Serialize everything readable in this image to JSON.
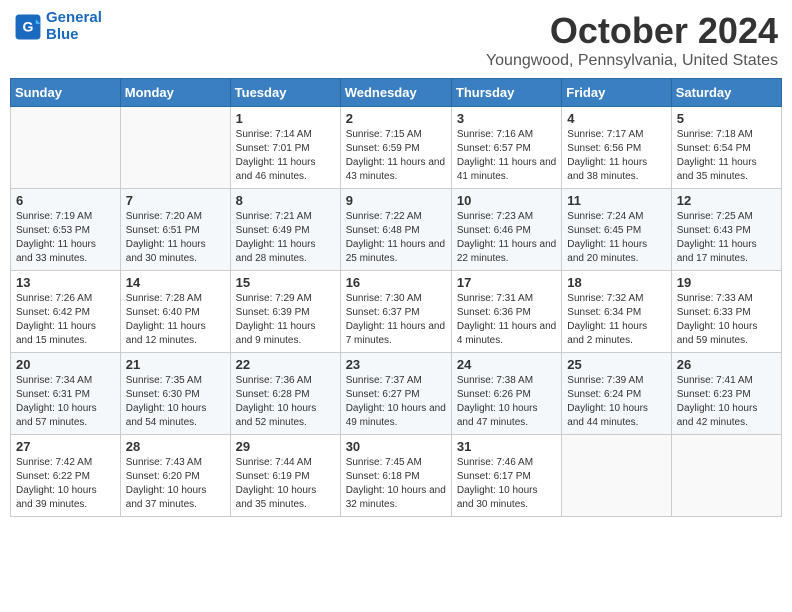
{
  "header": {
    "logo_line1": "General",
    "logo_line2": "Blue",
    "month": "October 2024",
    "location": "Youngwood, Pennsylvania, United States"
  },
  "weekdays": [
    "Sunday",
    "Monday",
    "Tuesday",
    "Wednesday",
    "Thursday",
    "Friday",
    "Saturday"
  ],
  "weeks": [
    [
      {
        "day": "",
        "sunrise": "",
        "sunset": "",
        "daylight": ""
      },
      {
        "day": "",
        "sunrise": "",
        "sunset": "",
        "daylight": ""
      },
      {
        "day": "1",
        "sunrise": "Sunrise: 7:14 AM",
        "sunset": "Sunset: 7:01 PM",
        "daylight": "Daylight: 11 hours and 46 minutes."
      },
      {
        "day": "2",
        "sunrise": "Sunrise: 7:15 AM",
        "sunset": "Sunset: 6:59 PM",
        "daylight": "Daylight: 11 hours and 43 minutes."
      },
      {
        "day": "3",
        "sunrise": "Sunrise: 7:16 AM",
        "sunset": "Sunset: 6:57 PM",
        "daylight": "Daylight: 11 hours and 41 minutes."
      },
      {
        "day": "4",
        "sunrise": "Sunrise: 7:17 AM",
        "sunset": "Sunset: 6:56 PM",
        "daylight": "Daylight: 11 hours and 38 minutes."
      },
      {
        "day": "5",
        "sunrise": "Sunrise: 7:18 AM",
        "sunset": "Sunset: 6:54 PM",
        "daylight": "Daylight: 11 hours and 35 minutes."
      }
    ],
    [
      {
        "day": "6",
        "sunrise": "Sunrise: 7:19 AM",
        "sunset": "Sunset: 6:53 PM",
        "daylight": "Daylight: 11 hours and 33 minutes."
      },
      {
        "day": "7",
        "sunrise": "Sunrise: 7:20 AM",
        "sunset": "Sunset: 6:51 PM",
        "daylight": "Daylight: 11 hours and 30 minutes."
      },
      {
        "day": "8",
        "sunrise": "Sunrise: 7:21 AM",
        "sunset": "Sunset: 6:49 PM",
        "daylight": "Daylight: 11 hours and 28 minutes."
      },
      {
        "day": "9",
        "sunrise": "Sunrise: 7:22 AM",
        "sunset": "Sunset: 6:48 PM",
        "daylight": "Daylight: 11 hours and 25 minutes."
      },
      {
        "day": "10",
        "sunrise": "Sunrise: 7:23 AM",
        "sunset": "Sunset: 6:46 PM",
        "daylight": "Daylight: 11 hours and 22 minutes."
      },
      {
        "day": "11",
        "sunrise": "Sunrise: 7:24 AM",
        "sunset": "Sunset: 6:45 PM",
        "daylight": "Daylight: 11 hours and 20 minutes."
      },
      {
        "day": "12",
        "sunrise": "Sunrise: 7:25 AM",
        "sunset": "Sunset: 6:43 PM",
        "daylight": "Daylight: 11 hours and 17 minutes."
      }
    ],
    [
      {
        "day": "13",
        "sunrise": "Sunrise: 7:26 AM",
        "sunset": "Sunset: 6:42 PM",
        "daylight": "Daylight: 11 hours and 15 minutes."
      },
      {
        "day": "14",
        "sunrise": "Sunrise: 7:28 AM",
        "sunset": "Sunset: 6:40 PM",
        "daylight": "Daylight: 11 hours and 12 minutes."
      },
      {
        "day": "15",
        "sunrise": "Sunrise: 7:29 AM",
        "sunset": "Sunset: 6:39 PM",
        "daylight": "Daylight: 11 hours and 9 minutes."
      },
      {
        "day": "16",
        "sunrise": "Sunrise: 7:30 AM",
        "sunset": "Sunset: 6:37 PM",
        "daylight": "Daylight: 11 hours and 7 minutes."
      },
      {
        "day": "17",
        "sunrise": "Sunrise: 7:31 AM",
        "sunset": "Sunset: 6:36 PM",
        "daylight": "Daylight: 11 hours and 4 minutes."
      },
      {
        "day": "18",
        "sunrise": "Sunrise: 7:32 AM",
        "sunset": "Sunset: 6:34 PM",
        "daylight": "Daylight: 11 hours and 2 minutes."
      },
      {
        "day": "19",
        "sunrise": "Sunrise: 7:33 AM",
        "sunset": "Sunset: 6:33 PM",
        "daylight": "Daylight: 10 hours and 59 minutes."
      }
    ],
    [
      {
        "day": "20",
        "sunrise": "Sunrise: 7:34 AM",
        "sunset": "Sunset: 6:31 PM",
        "daylight": "Daylight: 10 hours and 57 minutes."
      },
      {
        "day": "21",
        "sunrise": "Sunrise: 7:35 AM",
        "sunset": "Sunset: 6:30 PM",
        "daylight": "Daylight: 10 hours and 54 minutes."
      },
      {
        "day": "22",
        "sunrise": "Sunrise: 7:36 AM",
        "sunset": "Sunset: 6:28 PM",
        "daylight": "Daylight: 10 hours and 52 minutes."
      },
      {
        "day": "23",
        "sunrise": "Sunrise: 7:37 AM",
        "sunset": "Sunset: 6:27 PM",
        "daylight": "Daylight: 10 hours and 49 minutes."
      },
      {
        "day": "24",
        "sunrise": "Sunrise: 7:38 AM",
        "sunset": "Sunset: 6:26 PM",
        "daylight": "Daylight: 10 hours and 47 minutes."
      },
      {
        "day": "25",
        "sunrise": "Sunrise: 7:39 AM",
        "sunset": "Sunset: 6:24 PM",
        "daylight": "Daylight: 10 hours and 44 minutes."
      },
      {
        "day": "26",
        "sunrise": "Sunrise: 7:41 AM",
        "sunset": "Sunset: 6:23 PM",
        "daylight": "Daylight: 10 hours and 42 minutes."
      }
    ],
    [
      {
        "day": "27",
        "sunrise": "Sunrise: 7:42 AM",
        "sunset": "Sunset: 6:22 PM",
        "daylight": "Daylight: 10 hours and 39 minutes."
      },
      {
        "day": "28",
        "sunrise": "Sunrise: 7:43 AM",
        "sunset": "Sunset: 6:20 PM",
        "daylight": "Daylight: 10 hours and 37 minutes."
      },
      {
        "day": "29",
        "sunrise": "Sunrise: 7:44 AM",
        "sunset": "Sunset: 6:19 PM",
        "daylight": "Daylight: 10 hours and 35 minutes."
      },
      {
        "day": "30",
        "sunrise": "Sunrise: 7:45 AM",
        "sunset": "Sunset: 6:18 PM",
        "daylight": "Daylight: 10 hours and 32 minutes."
      },
      {
        "day": "31",
        "sunrise": "Sunrise: 7:46 AM",
        "sunset": "Sunset: 6:17 PM",
        "daylight": "Daylight: 10 hours and 30 minutes."
      },
      {
        "day": "",
        "sunrise": "",
        "sunset": "",
        "daylight": ""
      },
      {
        "day": "",
        "sunrise": "",
        "sunset": "",
        "daylight": ""
      }
    ]
  ]
}
